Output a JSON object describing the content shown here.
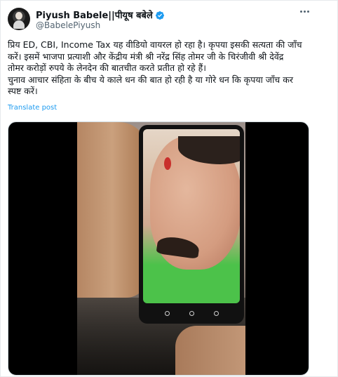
{
  "author": {
    "display_name": "Piyush Babele||पीयूष बबेले",
    "handle": "@BabelePiyush"
  },
  "tweet": {
    "lines": [
      "प्रिय ED, CBI, Income Tax यह वीडियो वायरल हो रहा है। कृपया इसकी सत्यता की जाँच",
      "करें। इसमें भाजपा प्रत्याशी और केंद्रीय मंत्री श्री नरेंद्र सिंह तोमर जी के चिरंजीवी श्री देवेंद्र",
      "तोमर करोड़ों रुपये के लेनदेन की बातचीत करते प्रतीत हो रहे हैं।",
      "चुनाव आचार संहिता के बीच ये काले धन की बात हो रही है या गोरे धन कि कृपया जाँच कर",
      "स्पष्ट करें।"
    ],
    "translate_label": "Translate post"
  },
  "icons": {
    "verified": "verified-badge-icon",
    "more": "more-options-icon"
  },
  "colors": {
    "link": "#1d9bf0",
    "verified": "#1d9bf0",
    "secondary_text": "#536471"
  }
}
